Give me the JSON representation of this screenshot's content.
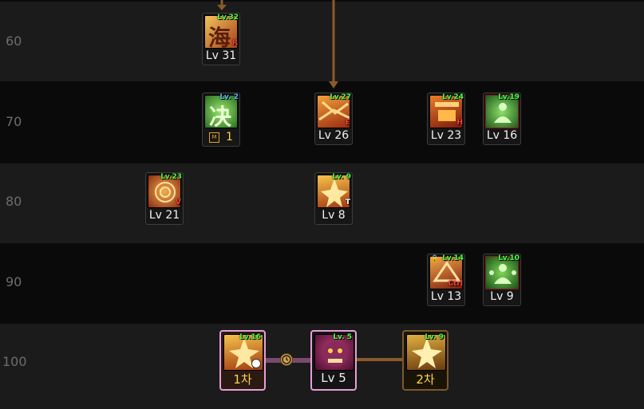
{
  "rows": [
    {
      "label": "60"
    },
    {
      "label": "70"
    },
    {
      "label": "80"
    },
    {
      "label": "90"
    },
    {
      "label": "100"
    }
  ],
  "skills": {
    "s60a": {
      "badge": "Lv.32",
      "hotkey": "R",
      "level_text": "Lv 31",
      "glyph": "海"
    },
    "s70a": {
      "badge": "Lv. 2",
      "mastery_icon": "M",
      "level_text": "1",
      "glyph": "决"
    },
    "s70b": {
      "badge": "Lv.27",
      "hotkey": "E",
      "level_text": "Lv 26"
    },
    "s70c": {
      "badge": "Lv.24",
      "hotkey": "H",
      "level_text": "Lv 23"
    },
    "s70d": {
      "badge": "Lv.19",
      "level_text": "Lv 16"
    },
    "s80a": {
      "badge": "Lv.23",
      "hotkey": "V",
      "level_text": "Lv 21"
    },
    "s80b": {
      "badge": "Lv. 9",
      "hotkey": "T",
      "level_text": "Lv 8"
    },
    "s90a": {
      "badge": "Lv.14",
      "hotkey": "Ctrl",
      "level_text": "Lv 13"
    },
    "s90b": {
      "badge": "Lv.10",
      "level_text": "Lv 9"
    },
    "s100a": {
      "badge": "Lv.16",
      "level_text": "1차"
    },
    "s100b": {
      "badge": "Lv. 5",
      "level_text": "Lv 5"
    },
    "s100c": {
      "badge": "Lv. 9",
      "level_text": "2차"
    }
  },
  "icons": {
    "timer": "clock-icon",
    "lock": "lock-icon"
  },
  "colors": {
    "row_light": "#1b1b1b",
    "row_dark": "#0a0a0a",
    "badge_green": "#48ff48",
    "badge_blue": "#56b7ff",
    "hotkey_red": "#ff3c3c",
    "connector": "#8a5a2b",
    "awakening_pink": "#e6a0d8",
    "awakening_gold": "#c9a45a"
  }
}
